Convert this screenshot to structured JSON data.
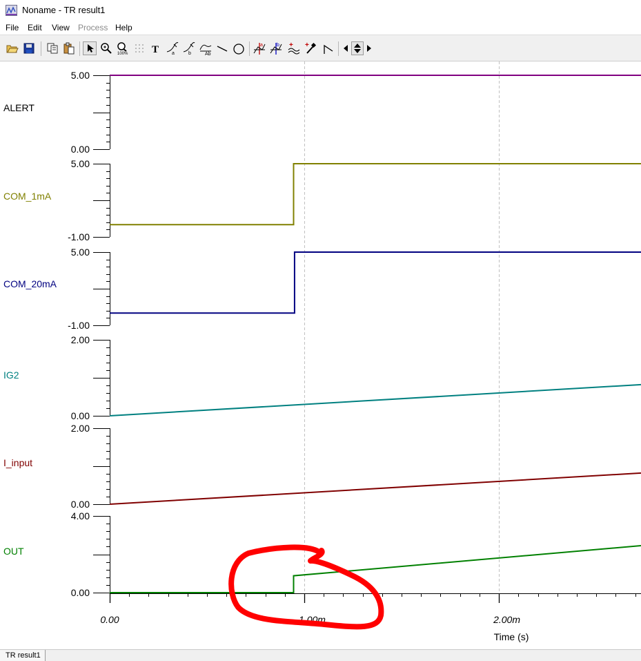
{
  "window": {
    "title": "Noname - TR result1"
  },
  "menu": [
    {
      "label": "File",
      "enabled": true
    },
    {
      "label": "Edit",
      "enabled": true
    },
    {
      "label": "View",
      "enabled": true
    },
    {
      "label": "Process",
      "enabled": false
    },
    {
      "label": "Help",
      "enabled": true
    }
  ],
  "toolbar": {
    "buttons": [
      "open-folder-icon",
      "save-icon",
      "copy-icon",
      "paste-icon",
      "select-arrow-icon",
      "zoom-in-icon",
      "zoom-100-icon",
      "grid-icon",
      "text-tool-icon",
      "curve-a-icon",
      "curve-b-icon",
      "formula-icon",
      "line-tool-icon",
      "ellipse-tool-icon",
      "cursor-a-icon",
      "cursor-b-icon",
      "add-trace-icon",
      "probe-icon",
      "step-icon",
      "arrow-left-icon",
      "arrow-updown-icon",
      "arrow-right-icon"
    ]
  },
  "colors": {
    "ALERT": "#800080",
    "COM_1mA": "#808000",
    "COM_20mA": "#000080",
    "IG2": "#008080",
    "I_input": "#800000",
    "OUT": "#008000",
    "annotation": "#ff0000"
  },
  "chart_data": {
    "type": "line",
    "xlabel": "Time (s)",
    "x_unit": "s",
    "xlim": [
      0,
      0.00273
    ],
    "x_ticks": [
      {
        "value": 0,
        "label": "0.00"
      },
      {
        "value": 0.001,
        "label": "1.00m"
      },
      {
        "value": 0.002,
        "label": "2.00m"
      }
    ],
    "grid": "vertical dashed at major ticks",
    "series": [
      {
        "name": "ALERT",
        "ylim": [
          0,
          5
        ],
        "ytick_labels": [
          "5.00",
          "0.00"
        ],
        "points": [
          [
            0,
            5
          ],
          [
            0.00273,
            5
          ]
        ]
      },
      {
        "name": "COM_1mA",
        "ylim": [
          -1,
          5
        ],
        "ytick_labels": [
          "5.00",
          "-1.00"
        ],
        "points": [
          [
            0,
            0
          ],
          [
            0.000945,
            0
          ],
          [
            0.000945,
            5
          ],
          [
            0.00273,
            5
          ]
        ]
      },
      {
        "name": "COM_20mA",
        "ylim": [
          -1,
          5
        ],
        "ytick_labels": [
          "5.00",
          "-1.00"
        ],
        "points": [
          [
            0,
            0
          ],
          [
            0.00095,
            0
          ],
          [
            0.00095,
            5
          ],
          [
            0.00273,
            5
          ]
        ]
      },
      {
        "name": "IG2",
        "ylim": [
          0,
          2
        ],
        "ytick_labels": [
          "2.00",
          "0.00"
        ],
        "points": [
          [
            0,
            0
          ],
          [
            0.00273,
            0.82
          ]
        ]
      },
      {
        "name": "I_input",
        "ylim": [
          0,
          2
        ],
        "ytick_labels": [
          "2.00",
          "0.00"
        ],
        "points": [
          [
            0,
            0
          ],
          [
            0.00273,
            0.82
          ]
        ]
      },
      {
        "name": "OUT",
        "ylim": [
          0,
          4
        ],
        "ytick_labels": [
          "4.00",
          "0.00"
        ],
        "points": [
          [
            0,
            0
          ],
          [
            0.000945,
            0
          ],
          [
            0.000945,
            0.88
          ],
          [
            0.00273,
            2.45
          ]
        ]
      }
    ]
  },
  "statusbar": {
    "tab": "TR result1"
  }
}
